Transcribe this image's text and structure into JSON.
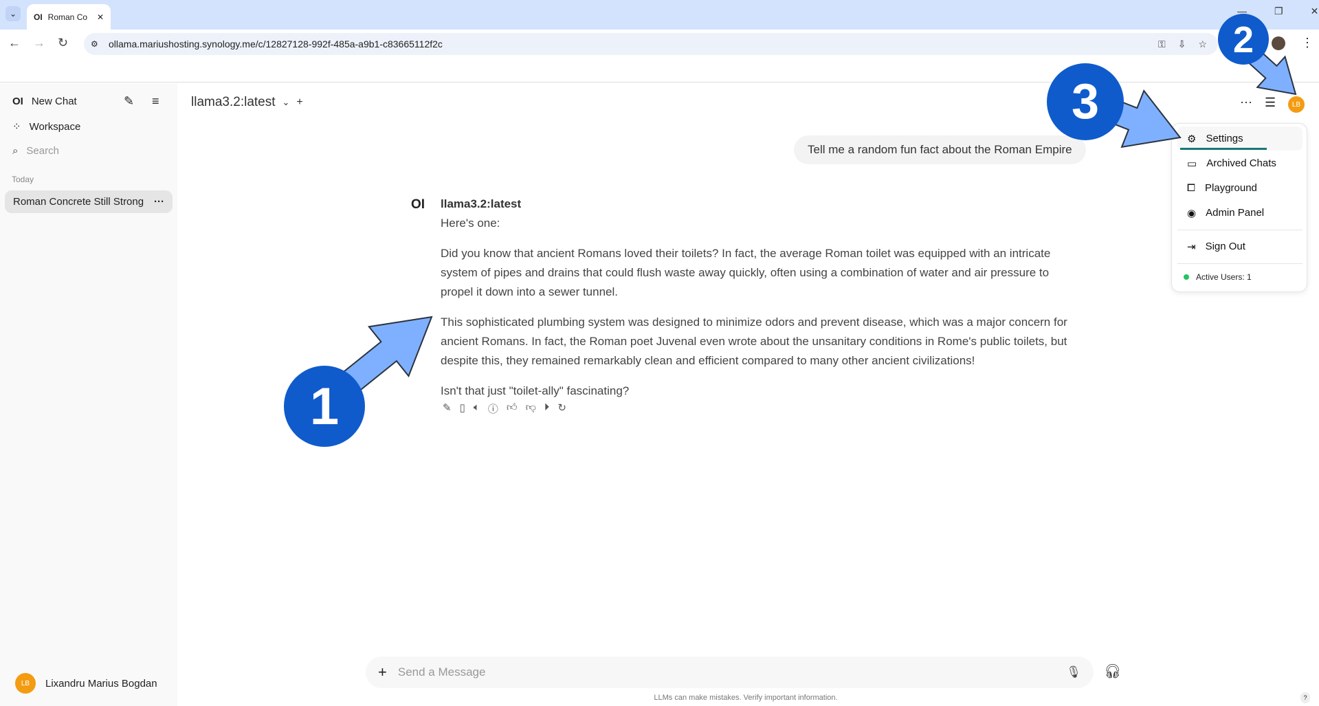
{
  "browser": {
    "tab_title": "Roman Co",
    "url": "ollama.mariushosting.synology.me/c/12827128-992f-485a-a9b1-c83665112f2c"
  },
  "sidebar": {
    "logo": "OI",
    "new_chat": "New Chat",
    "workspace": "Workspace",
    "search_placeholder": "Search",
    "section": "Today",
    "chats": [
      {
        "title": "Roman Concrete Still Strong"
      }
    ],
    "user": {
      "initials": "LB",
      "name": "Lixandru Marius Bogdan"
    }
  },
  "header": {
    "model": "llama3.2:latest",
    "avatar_initials": "LB"
  },
  "conversation": {
    "user_message": "Tell me a random fun fact about the Roman Empire",
    "assistant": {
      "logo": "OI",
      "name": "llama3.2:latest",
      "paragraphs": [
        "Here's one:",
        "Did you know that ancient Romans loved their toilets? In fact, the average Roman toilet was equipped with an intricate system of pipes and drains that could flush waste away quickly, often using a combination of water and air pressure to propel it down into a sewer tunnel.",
        "This sophisticated plumbing system was designed to minimize odors and prevent disease, which was a major concern for ancient Romans. In fact, the Roman poet Juvenal even wrote about the unsanitary conditions in Rome's public toilets, but despite this, they remained remarkably clean and efficient compared to many other ancient civilizations!",
        "Isn't that just \"toilet-ally\" fascinating?"
      ]
    }
  },
  "menu": {
    "items": [
      "Settings",
      "Archived Chats",
      "Playground",
      "Admin Panel"
    ],
    "sign_out": "Sign Out",
    "active_users": "Active Users: 1"
  },
  "input": {
    "placeholder": "Send a Message"
  },
  "footer": {
    "disclaimer": "LLMs can make mistakes. Verify important information.",
    "help": "?"
  },
  "annotations": {
    "labels": [
      "1",
      "2",
      "3"
    ],
    "circle_color": "#0f5bcc",
    "arrow_color": "#7fb0ff"
  }
}
